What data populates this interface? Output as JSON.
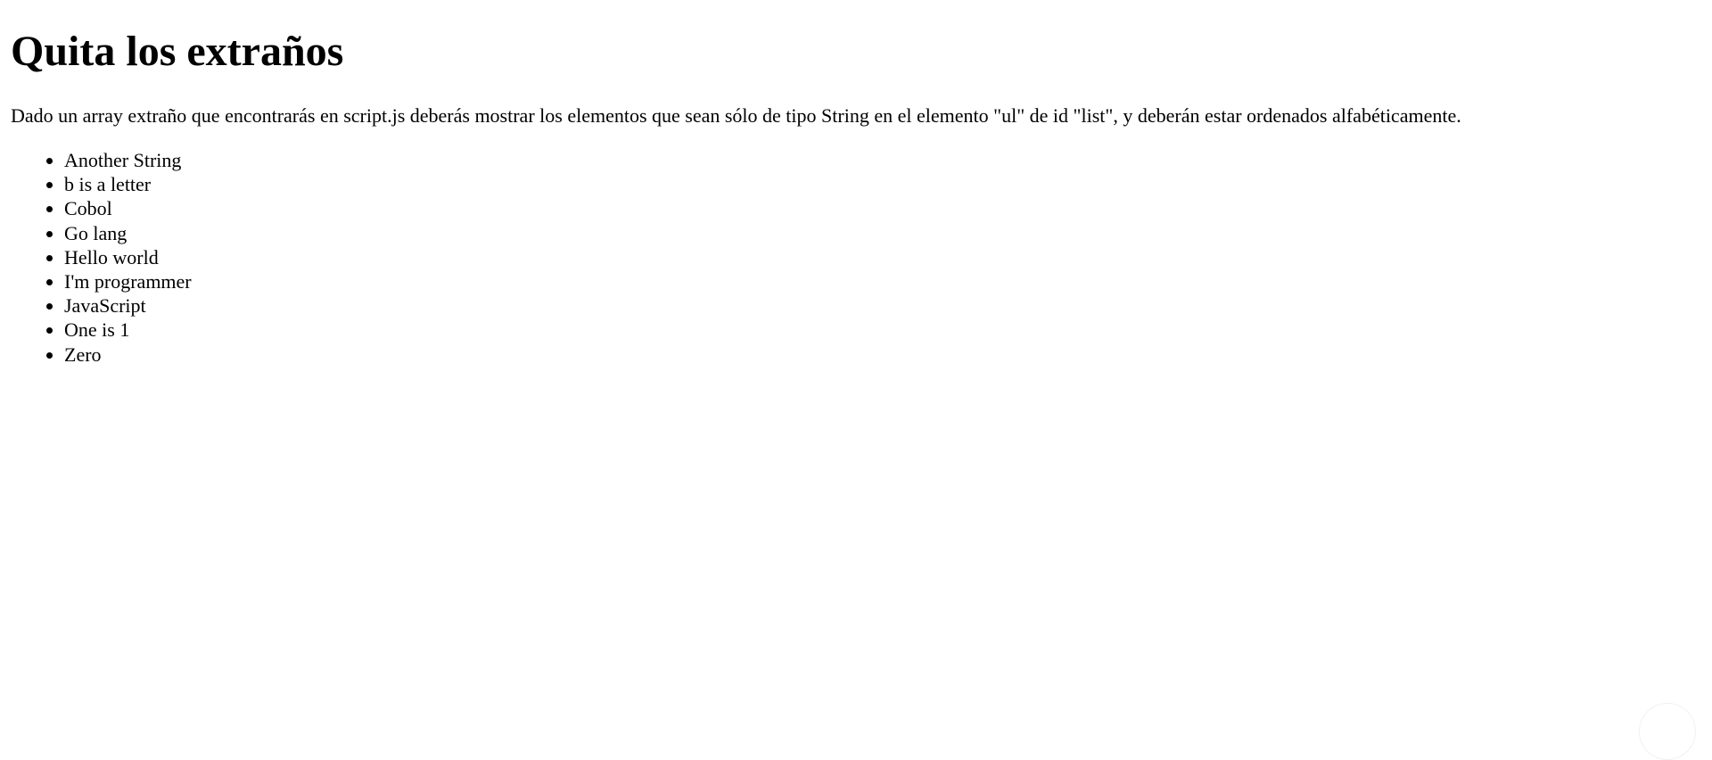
{
  "page": {
    "title": "Quita los extraños",
    "description": "Dado un array extraño que encontrarás en script.js deberás mostrar los elementos que sean sólo de tipo String en el elemento \"ul\" de id \"list\", y deberán estar ordenados alfabéticamente.",
    "list": [
      "Another String",
      "b is a letter",
      "Cobol",
      "Go lang",
      "Hello world",
      "I'm programmer",
      "JavaScript",
      "One is 1",
      "Zero"
    ]
  }
}
